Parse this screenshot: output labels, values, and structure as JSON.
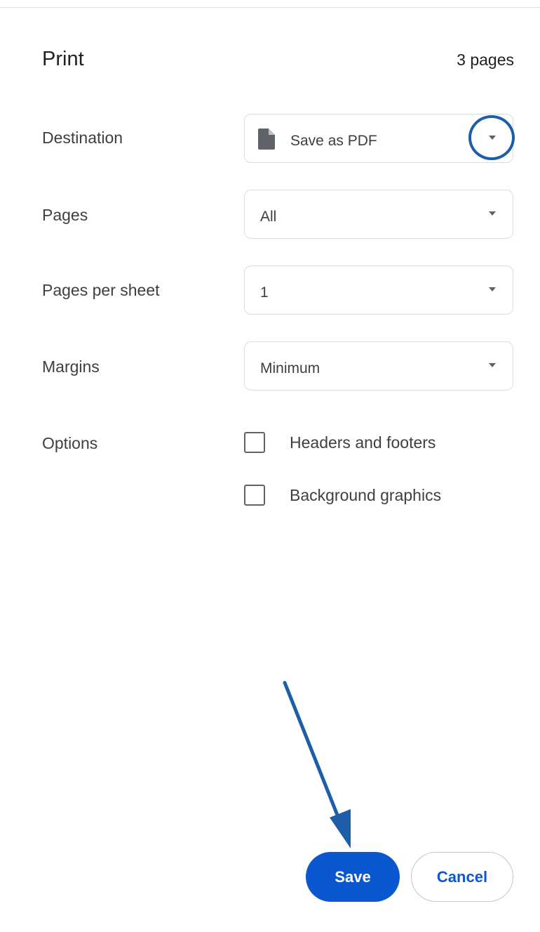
{
  "header": {
    "title": "Print",
    "page_count": "3 pages"
  },
  "destination": {
    "label": "Destination",
    "value": "Save as PDF",
    "icon": "file-icon"
  },
  "pages": {
    "label": "Pages",
    "value": "All"
  },
  "pages_per_sheet": {
    "label": "Pages per sheet",
    "value": "1"
  },
  "margins": {
    "label": "Margins",
    "value": "Minimum"
  },
  "options": {
    "label": "Options",
    "items": [
      {
        "label": "Headers and footers",
        "checked": false
      },
      {
        "label": "Background graphics",
        "checked": false
      }
    ]
  },
  "actions": {
    "save_label": "Save",
    "cancel_label": "Cancel"
  },
  "colors": {
    "accent": "#0b57d0",
    "annotation": "#1e5ea8",
    "border": "#dadce0",
    "text": "#3c4043"
  }
}
